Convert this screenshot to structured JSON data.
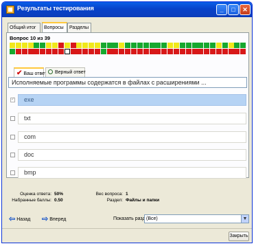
{
  "window": {
    "title": "Результаты тестирования"
  },
  "tabs": [
    {
      "label": "Общий итог",
      "active": false
    },
    {
      "label": "Вопросы",
      "active": true
    },
    {
      "label": "Разделы",
      "active": false
    }
  ],
  "question_counter": "Вопрос 10 из 39",
  "question_grid": {
    "colors": {
      "yellow": "#f0e81a",
      "red": "#d81818",
      "green": "#16a82e",
      "current": "#ffffff"
    },
    "row1": [
      "yellow",
      "yellow",
      "yellow",
      "yellow",
      "green",
      "green",
      "yellow",
      "yellow",
      "red",
      "yellow",
      "red",
      "yellow",
      "yellow",
      "yellow",
      "yellow",
      "green",
      "green",
      "green",
      "yellow",
      "green",
      "green",
      "green",
      "green",
      "green",
      "green",
      "green",
      "yellow",
      "yellow",
      "green",
      "green",
      "green",
      "green",
      "green",
      "green",
      "yellow",
      "green",
      "yellow",
      "green",
      "green"
    ],
    "row2": [
      "green",
      "red",
      "red",
      "red",
      "red",
      "red",
      "red",
      "red",
      "red",
      "current",
      "red",
      "red",
      "red",
      "red",
      "red",
      "green",
      "red",
      "red",
      "red",
      "red",
      "red",
      "red",
      "red",
      "red",
      "red",
      "red",
      "red",
      "red",
      "red",
      "red",
      "red",
      "red",
      "red",
      "red",
      "red",
      "red",
      "red",
      "red",
      "red"
    ]
  },
  "answer_tabs": {
    "your_answer": "Ваш ответ",
    "correct_answer": "Верный ответ"
  },
  "question_text": "Исполняемые программы содержатся в файлах с расширениями ...",
  "answers": [
    {
      "label": "exe",
      "checked": true,
      "selected": true
    },
    {
      "label": "txt",
      "checked": false,
      "selected": false
    },
    {
      "label": "com",
      "checked": false,
      "selected": false
    },
    {
      "label": "doc",
      "checked": false,
      "selected": false
    },
    {
      "label": "bmp",
      "checked": false,
      "selected": false
    }
  ],
  "stats": {
    "score_label": "Оценка ответа:",
    "score_value": "50%",
    "points_label": "Набранные баллы:",
    "points_value": "0.50",
    "weight_label": "Вес вопроса:",
    "weight_value": "1",
    "section_label": "Раздел:",
    "section_value": "Файлы и папки"
  },
  "nav": {
    "back": "Назад",
    "forward": "Вперед",
    "show_section_label": "Показать раздел:",
    "show_section_value": "(Все)"
  },
  "close_label": "Закрыть"
}
